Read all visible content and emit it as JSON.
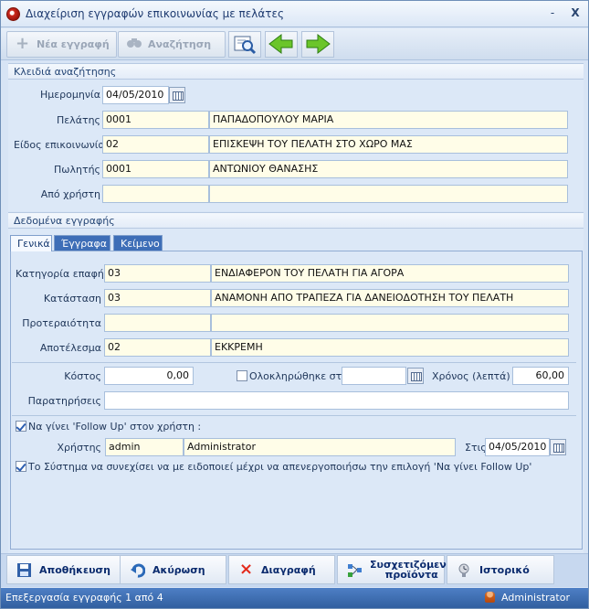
{
  "window": {
    "title": "Διαχείριση εγγραφών επικοινωνίας με πελάτες",
    "minimize": "-",
    "close": "X"
  },
  "toolbar": {
    "new_record": "Νέα εγγραφή",
    "search": "Αναζήτηση"
  },
  "search_section": {
    "header": "Κλειδιά αναζήτησης",
    "date_label": "Ημερομηνία",
    "date_value": "04/05/2010",
    "customer_label": "Πελάτης",
    "customer_code": "0001",
    "customer_name": "ΠΑΠΑΔΟΠΟΥΛΟΥ ΜΑΡΙΑ",
    "contact_type_label": "Είδος επικοινωνίας",
    "contact_type_code": "02",
    "contact_type_name": "ΕΠΙΣΚΕΨΗ ΤΟΥ ΠΕΛΑΤΗ ΣΤΟ ΧΩΡΟ ΜΑΣ",
    "seller_label": "Πωλητής",
    "seller_code": "0001",
    "seller_name": "ΑΝΤΩΝΙΟΥ ΘΑΝΑΣΗΣ",
    "from_user_label": "Από χρήστη",
    "from_user_code": "",
    "from_user_name": ""
  },
  "record_section": {
    "header": "Δεδομένα εγγραφής",
    "tabs": [
      {
        "label": "Γενικά",
        "active": true
      },
      {
        "label": "Έγγραφα",
        "active": false
      },
      {
        "label": "Κείμενο",
        "active": false
      }
    ],
    "category_label": "Κατηγορία επαφής",
    "category_code": "03",
    "category_name": "ΕΝΔΙΑΦΕΡΟΝ ΤΟΥ ΠΕΛΑΤΗ ΓΙΑ ΑΓΟΡΑ",
    "status_label": "Κατάσταση",
    "status_code": "03",
    "status_name": "ΑΝΑΜΟΝΗ ΑΠΟ ΤΡΑΠΕΖΑ ΓΙΑ ΔΑΝΕΙΟΔΟΤΗΣΗ ΤΟΥ ΠΕΛΑΤΗ",
    "priority_label": "Προτεραιότητα",
    "priority_code": "",
    "priority_name": "",
    "result_label": "Αποτέλεσμα",
    "result_code": "02",
    "result_name": "ΕΚΚΡΕΜΗ",
    "cost_label": "Κόστος",
    "cost_value": "0,00",
    "completed_label": "Ολοκληρώθηκε στις",
    "completed_value": "",
    "time_label": "Χρόνος (λεπτά)",
    "time_value": "60,00",
    "notes_label": "Παρατηρήσεις",
    "notes_value": "",
    "followup_label": "Να γίνει 'Follow Up' στον χρήστη :",
    "user_label": "Χρήστης",
    "user_code": "admin",
    "user_name": "Administrator",
    "on_label": "Στις",
    "on_value": "04/05/2010",
    "notify_label": "Το Σύστημα να συνεχίσει να με ειδοποιεί μέχρι να απενεργοποιήσω την επιλογή 'Να γίνει Follow Up'"
  },
  "buttons": {
    "save": "Αποθήκευση",
    "cancel": "Ακύρωση",
    "delete": "Διαγραφή",
    "related_products_line1": "Συσχετιζόμενα",
    "related_products_line2": "προϊόντα",
    "history": "Ιστορικό"
  },
  "status_bar": {
    "message": "Επεξεργασία εγγραφής 1 από 4",
    "user": "Administrator"
  }
}
